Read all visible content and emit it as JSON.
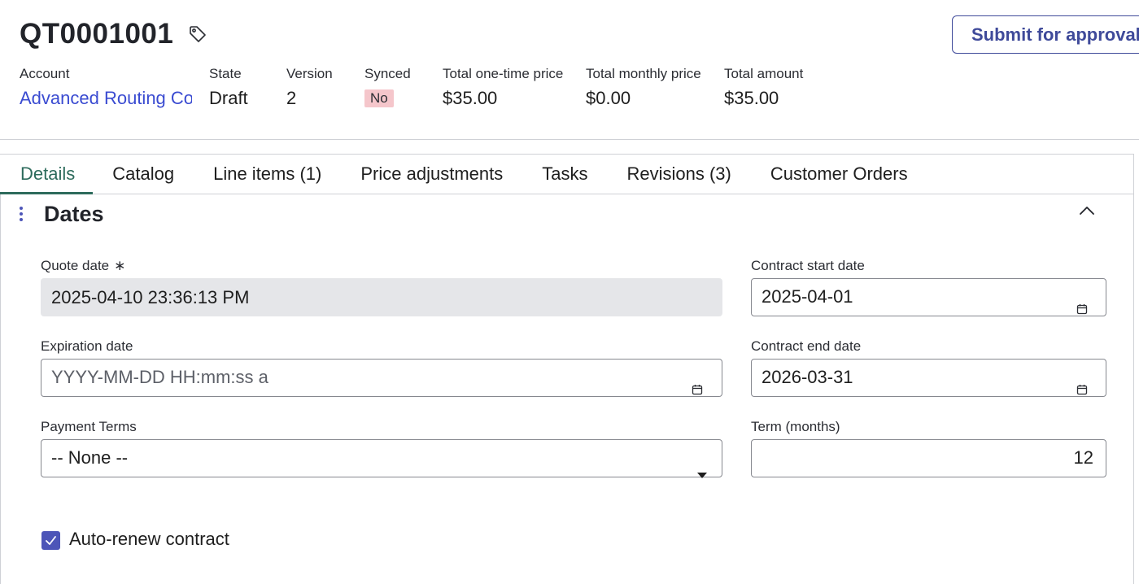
{
  "header": {
    "title": "QT0001001",
    "submit_label": "Submit for approval",
    "meta": {
      "account_label": "Account",
      "account_value": "Advanced Routing Co",
      "state_label": "State",
      "state_value": "Draft",
      "version_label": "Version",
      "version_value": "2",
      "synced_label": "Synced",
      "synced_value": "No",
      "onetime_label": "Total one-time price",
      "onetime_value": "$35.00",
      "monthly_label": "Total monthly price",
      "monthly_value": "$0.00",
      "amount_label": "Total amount",
      "amount_value": "$35.00"
    }
  },
  "tabs": [
    {
      "label": "Details"
    },
    {
      "label": "Catalog"
    },
    {
      "label": "Line items (1)"
    },
    {
      "label": "Price adjustments"
    },
    {
      "label": "Tasks"
    },
    {
      "label": "Revisions (3)"
    },
    {
      "label": "Customer Orders"
    }
  ],
  "section": {
    "title": "Dates",
    "quote_date_label": "Quote date",
    "quote_date_value": "2025-04-10 23:36:13 PM",
    "required_marker": "∗",
    "contract_start_label": "Contract start date",
    "contract_start_value": "2025-04-01",
    "expiration_label": "Expiration date",
    "expiration_placeholder": "YYYY-MM-DD HH:mm:ss a",
    "contract_end_label": "Contract end date",
    "contract_end_value": "2026-03-31",
    "payment_terms_label": "Payment Terms",
    "payment_terms_value": "-- None --",
    "term_label": "Term (months)",
    "term_value": "12",
    "auto_renew_label": "Auto-renew contract",
    "auto_renew_checked": true
  },
  "colors": {
    "accent": "#3f4a9a",
    "link": "#3a4bd1",
    "active_tab": "#2d6b5c",
    "badge_no": "#f5c6cb",
    "checkbox": "#4d55b8"
  }
}
